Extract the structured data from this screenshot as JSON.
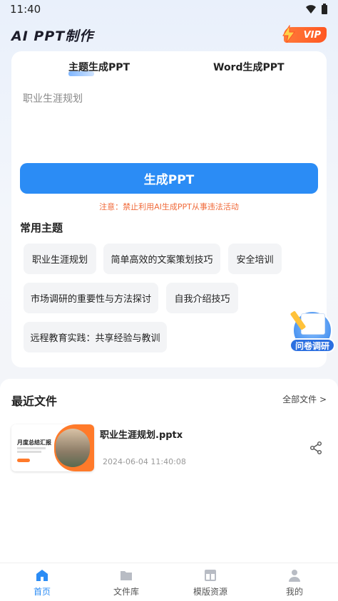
{
  "status_bar": {
    "time": "11:40"
  },
  "header": {
    "title": "AI PPT制作",
    "vip_label": "VIP"
  },
  "generator": {
    "tabs": [
      {
        "label": "主题生成PPT",
        "active": true
      },
      {
        "label": "Word生成PPT",
        "active": false
      }
    ],
    "topic_input_value": "职业生涯规划",
    "generate_button": "生成PPT",
    "notice": "注意：禁止利用AI生成PPT从事违法活动"
  },
  "common_topics": {
    "title": "常用主题",
    "items": [
      "职业生涯规划",
      "简单高效的文案策划技巧",
      "安全培训",
      "市场调研的重要性与方法探讨",
      "自我介绍技巧",
      "远程教育实践：共享经验与教训"
    ]
  },
  "survey": {
    "label": "问卷调研"
  },
  "recent_files": {
    "title": "最近文件",
    "all_link": "全部文件 >",
    "files": [
      {
        "name": "职业生涯规划.pptx",
        "date": "2024-06-04 11:40:08",
        "thumb_title": "月度总结汇报"
      }
    ]
  },
  "bottom_nav": [
    {
      "label": "首页",
      "icon": "home-icon",
      "active": true
    },
    {
      "label": "文件库",
      "icon": "folder-icon",
      "active": false
    },
    {
      "label": "模版资源",
      "icon": "template-icon",
      "active": false
    },
    {
      "label": "我的",
      "icon": "user-icon",
      "active": false
    }
  ],
  "colors": {
    "primary": "#2b8cf5",
    "warning": "#f06a3a",
    "vip": "#ff5722"
  }
}
